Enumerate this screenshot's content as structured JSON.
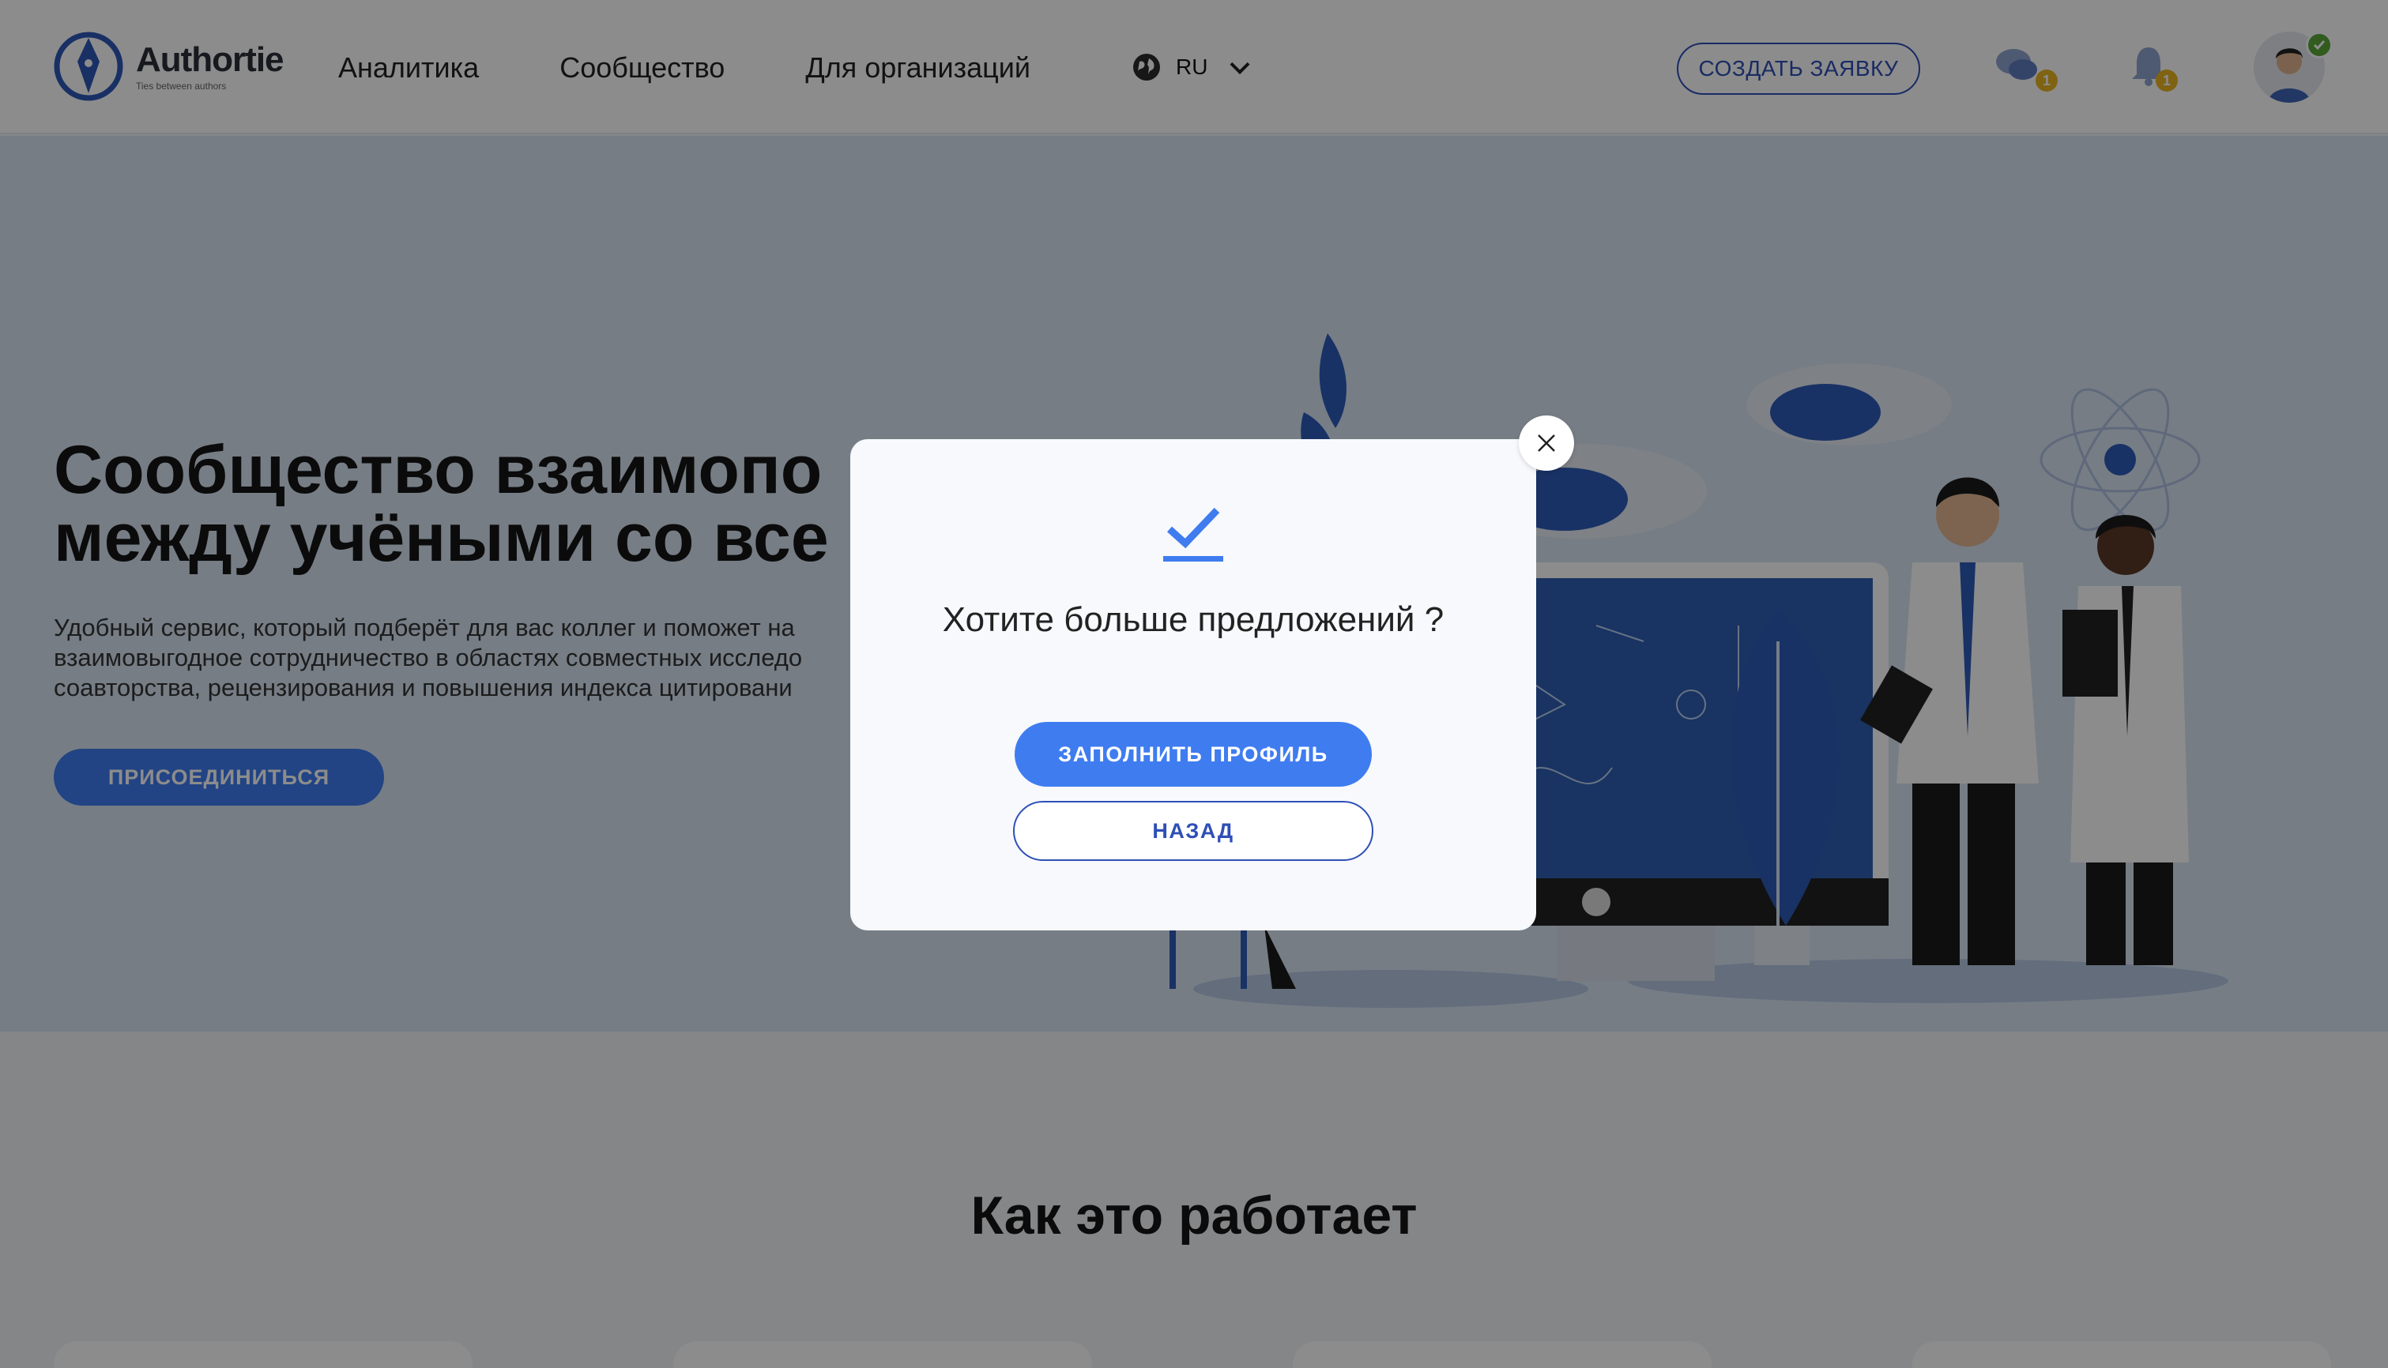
{
  "header": {
    "logo": {
      "name": "Authortie",
      "tagline": "Ties between authors"
    },
    "nav": [
      "Аналитика",
      "Сообщество",
      "Для организаций"
    ],
    "language": "RU",
    "create_button": "СОЗДАТЬ ЗАЯВКУ",
    "messages_badge": "1",
    "notifications_badge": "1"
  },
  "hero": {
    "title_line1": "Сообщество взаимопо",
    "title_line2": "между учёными со все",
    "description_line1": "Удобный сервис, который подберёт для вас коллег и поможет на",
    "description_line2": "взаимовыгодное сотрудничество в областях совместных исследо",
    "description_line3": "соавторства, рецензирования и повышения индекса цитировани",
    "join_button": "ПРИСОЕДИНИТЬСЯ"
  },
  "section": {
    "title": "Как это работает"
  },
  "modal": {
    "title": "Хотите больше предложений ?",
    "primary_button": "ЗАПОЛНИТЬ ПРОФИЛЬ",
    "secondary_button": "НАЗАД"
  },
  "colors": {
    "accent": "#3f7cf0",
    "outline": "#2e4fb6",
    "badge": "#e8b423",
    "verified": "#5aa63a"
  }
}
